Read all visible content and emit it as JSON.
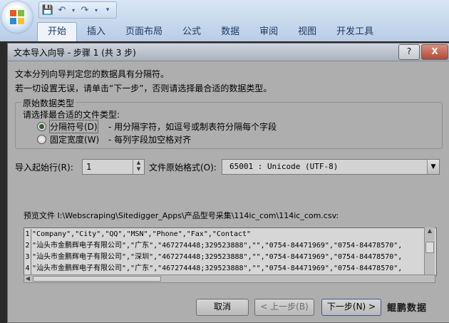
{
  "ribbon": {
    "tabs": [
      "开始",
      "插入",
      "页面布局",
      "公式",
      "数据",
      "审阅",
      "视图",
      "开发工具"
    ],
    "active_tab": 0,
    "logo_colors": [
      "#e8571e",
      "#7bbf3c",
      "#2f8ad9",
      "#f2c32c"
    ]
  },
  "dialog": {
    "title": "文本导入向导 - 步骤 1 (共 3 步)",
    "help_label": "?",
    "close_label": "X",
    "intro_line1": "文本分列向导判定您的数据具有分隔符。",
    "intro_line2": "若一切设置无误，请单击“下一步”，否则请选择最合适的数据类型。",
    "group_title": "原始数据类型",
    "choose_label": "请选择最合适的文件类型:",
    "options": [
      {
        "label": "分隔符号(D)",
        "desc": "- 用分隔字符，如逗号或制表符分隔每个字段",
        "checked": true
      },
      {
        "label": "固定宽度(W)",
        "desc": "- 每列字段加空格对齐",
        "checked": false
      }
    ],
    "start_row_label": "导入起始行(R):",
    "start_row_value": "1",
    "origin_label": "文件原始格式(O):",
    "origin_value": "65001 : Unicode (UTF-8)",
    "preview_label": "预览文件 I:\\Webscraping\\Sitedigger_Apps\\产品型号采集\\114ic_com\\114ic_com.csv:",
    "preview_rows": [
      {
        "num": "1",
        "text": "\"Company\",\"City\",\"QQ\",\"MSN\",\"Phone\",\"Fax\",\"Contact\""
      },
      {
        "num": "2",
        "text": "\"汕头市金鹏辉电子有限公司\",\"广东\",\"467274448;329523888\",\"\",\"0754-84471969\",\"0754-84478570\","
      },
      {
        "num": "3",
        "text": "\"汕头市金鹏辉电子有限公司\",\"深圳\",\"467274448;329523888\",\"\",\"0754-84471969\",\"0754-84478570\","
      },
      {
        "num": "4",
        "text": "\"汕头市金鹏辉电子有限公司\",\"广东\",\"467274448;329523888\",\"\",\"0754-84471969\",\"0754-84478570\","
      }
    ],
    "buttons": {
      "cancel": "取消",
      "back": "< 上一步(B)",
      "next": "下一步(N) >"
    },
    "watermark": "鲲鹏数据"
  }
}
